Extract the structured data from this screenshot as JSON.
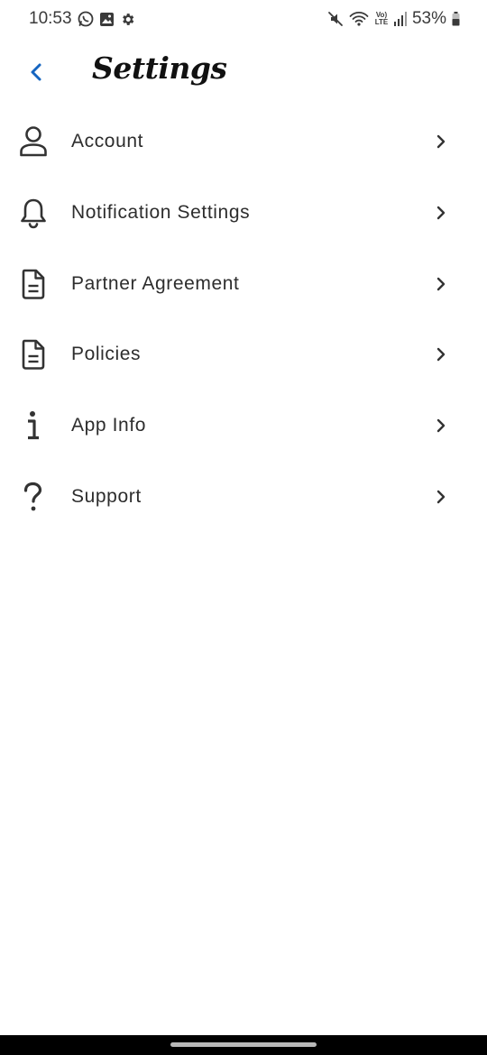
{
  "status_bar": {
    "time": "10:53",
    "battery": "53%",
    "network_label": "Vo) LTE",
    "left_icons": [
      "whatsapp-icon",
      "gallery-icon",
      "settings-gear-icon"
    ],
    "right_icons": [
      "mute-icon",
      "wifi-icon",
      "volte-icon",
      "signal-icon",
      "battery-icon"
    ]
  },
  "header": {
    "title": "Settings",
    "back_icon": "chevron-left-icon",
    "accent_color": "#1565c0"
  },
  "settings": {
    "items": [
      {
        "label": "Account",
        "icon": "person-icon"
      },
      {
        "label": "Notification Settings",
        "icon": "bell-icon"
      },
      {
        "label": "Partner Agreement",
        "icon": "document-icon"
      },
      {
        "label": "Policies",
        "icon": "document-icon"
      },
      {
        "label": "App Info",
        "icon": "info-icon"
      },
      {
        "label": "Support",
        "icon": "question-icon"
      }
    ]
  }
}
